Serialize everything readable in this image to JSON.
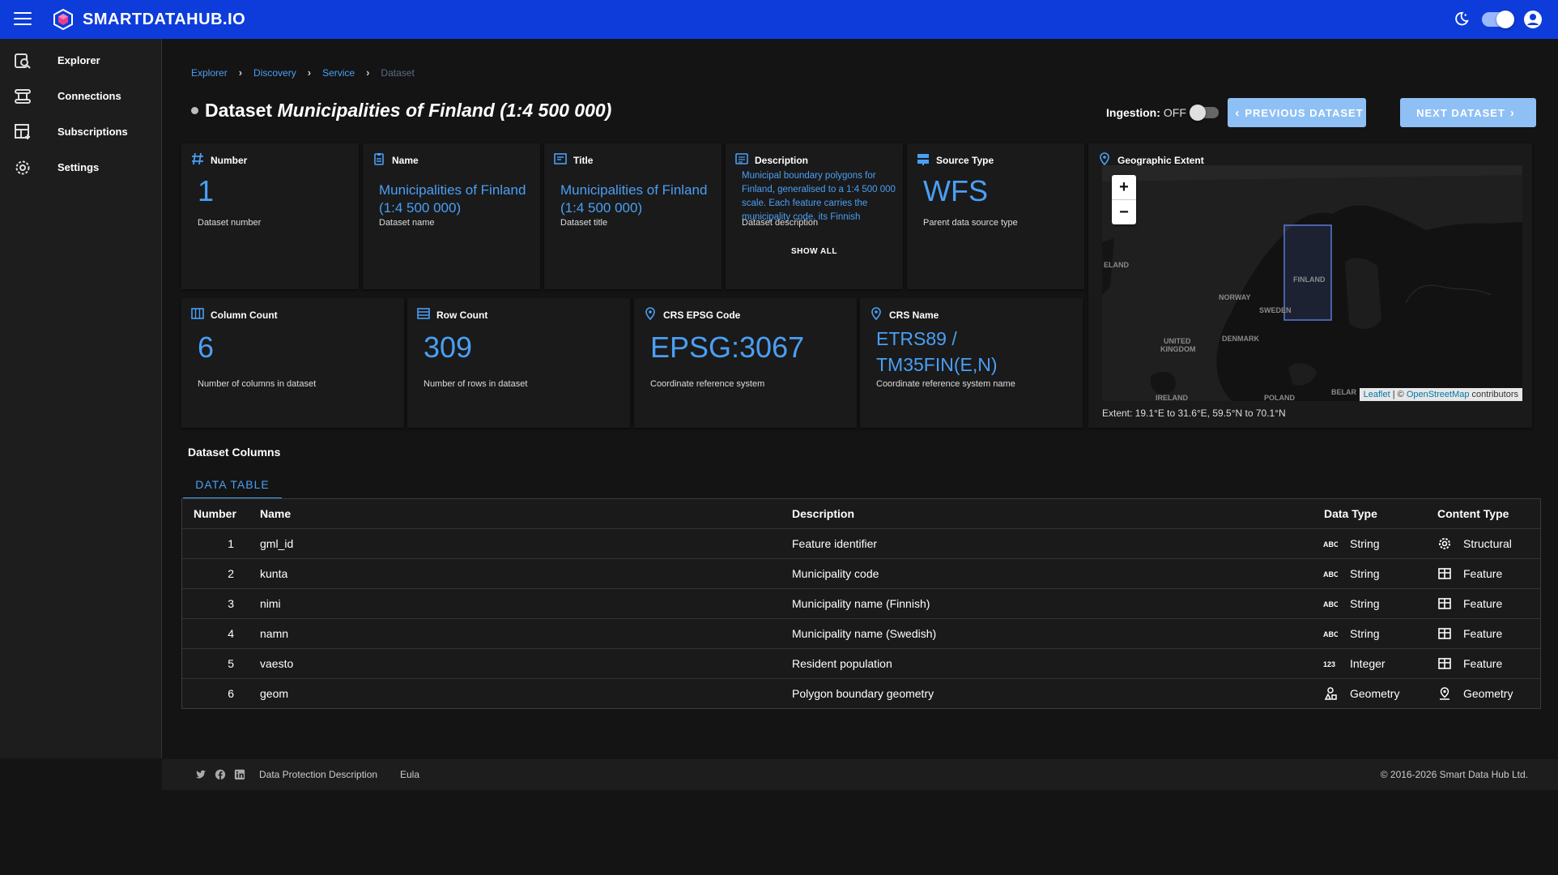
{
  "app": {
    "brand": "SMARTDATAHUB.IO"
  },
  "sidebar": {
    "items": [
      {
        "label": "Explorer",
        "icon": "explorer-icon"
      },
      {
        "label": "Connections",
        "icon": "connections-icon"
      },
      {
        "label": "Subscriptions",
        "icon": "subscriptions-icon"
      },
      {
        "label": "Settings",
        "icon": "gear-icon"
      }
    ]
  },
  "breadcrumb": [
    "Explorer",
    "Discovery",
    "Service",
    "Dataset"
  ],
  "page": {
    "title_prefix": "Dataset",
    "title_name": "Municipalities of Finland (1:4 500 000)"
  },
  "ingestion": {
    "label": "Ingestion:",
    "state": "OFF"
  },
  "buttons": {
    "prev": "PREVIOUS DATASET",
    "next": "NEXT DATASET"
  },
  "cards": {
    "number": {
      "title": "Number",
      "value": "1",
      "desc": "Dataset number"
    },
    "name": {
      "title": "Name",
      "value": "Municipalities of Finland (1:4 500 000)",
      "desc": "Dataset name"
    },
    "title": {
      "title": "Title",
      "value": "Municipalities of Finland (1:4 500 000)",
      "desc": "Dataset title"
    },
    "description": {
      "title": "Description",
      "value": "Municipal boundary polygons for Finland, generalised to a 1:4 500 000 scale. Each feature carries the municipality code, its Finnish",
      "desc": "Dataset description",
      "show_all": "SHOW ALL"
    },
    "source_type": {
      "title": "Source Type",
      "value": "WFS",
      "desc": "Parent data source type"
    },
    "column_count": {
      "title": "Column Count",
      "value": "6",
      "desc": "Number of columns in dataset"
    },
    "row_count": {
      "title": "Row Count",
      "value": "309",
      "desc": "Number of rows in dataset"
    },
    "crs_epsg": {
      "title": "CRS EPSG Code",
      "value": "EPSG:3067",
      "desc": "Coordinate reference system"
    },
    "crs_name": {
      "title": "CRS Name",
      "value": "ETRS89 / TM35FIN(E,N)",
      "desc": "Coordinate reference system name"
    }
  },
  "map": {
    "title": "Geographic Extent",
    "zoom_in": "+",
    "zoom_out": "−",
    "attribution": {
      "leaflet": "Leaflet",
      "sep": " | © ",
      "osm": "OpenStreetMap",
      "suffix": " contributors"
    },
    "labels": [
      "ELAND",
      "FINLAND",
      "NORWAY",
      "SWEDEN",
      "DENMARK",
      "UNITED",
      "KINGDOM",
      "IRELAND",
      "BELAR",
      "POLAND"
    ],
    "extent": "Extent: 19.1°E to 31.6°E, 59.5°N to 70.1°N"
  },
  "columns_section": {
    "title": "Dataset Columns",
    "tab": "DATA TABLE"
  },
  "table": {
    "headers": [
      "Number",
      "Name",
      "Description",
      "Data Type",
      "Content Type"
    ],
    "rows": [
      {
        "num": "1",
        "name": "gml_id",
        "desc": "Feature identifier",
        "dtype": "String",
        "dtype_icon": "abc-icon",
        "ctype": "Structural",
        "ctype_icon": "gear-icon"
      },
      {
        "num": "2",
        "name": "kunta",
        "desc": "Municipality code",
        "dtype": "String",
        "dtype_icon": "abc-icon",
        "ctype": "Feature",
        "ctype_icon": "table-icon"
      },
      {
        "num": "3",
        "name": "nimi",
        "desc": "Municipality name (Finnish)",
        "dtype": "String",
        "dtype_icon": "abc-icon",
        "ctype": "Feature",
        "ctype_icon": "table-icon"
      },
      {
        "num": "4",
        "name": "namn",
        "desc": "Municipality name (Swedish)",
        "dtype": "String",
        "dtype_icon": "abc-icon",
        "ctype": "Feature",
        "ctype_icon": "table-icon"
      },
      {
        "num": "5",
        "name": "vaesto",
        "desc": "Resident population",
        "dtype": "Integer",
        "dtype_icon": "123-icon",
        "ctype": "Feature",
        "ctype_icon": "table-icon"
      },
      {
        "num": "6",
        "name": "geom",
        "desc": "Polygon boundary geometry",
        "dtype": "Geometry",
        "dtype_icon": "shapes-icon",
        "ctype": "Geometry",
        "ctype_icon": "map-pin-icon"
      }
    ]
  },
  "footer": {
    "links": [
      "Data Protection Description",
      "Eula"
    ],
    "copyright": "© 2016-2026 Smart Data Hub Ltd."
  },
  "colors": {
    "topbar": "#0d3cdb",
    "accent": "#4a9ff5",
    "button": "#8fc0f5",
    "background": "#141414"
  }
}
